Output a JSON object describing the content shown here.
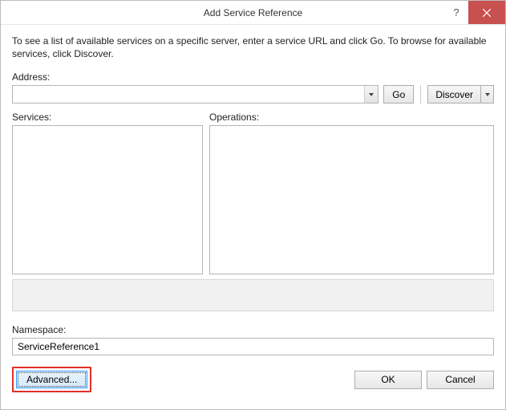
{
  "window": {
    "title": "Add Service Reference"
  },
  "instructions": "To see a list of available services on a specific server, enter a service URL and click Go. To browse for available services, click Discover.",
  "address": {
    "label": "Address:",
    "value": "",
    "go_label": "Go",
    "discover_label": "Discover"
  },
  "services": {
    "label": "Services:"
  },
  "operations": {
    "label": "Operations:"
  },
  "namespace": {
    "label": "Namespace:",
    "value": "ServiceReference1"
  },
  "buttons": {
    "advanced": "Advanced...",
    "ok": "OK",
    "cancel": "Cancel"
  }
}
